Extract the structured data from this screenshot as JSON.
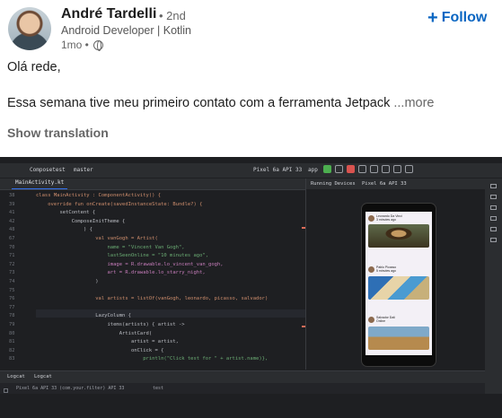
{
  "post": {
    "author_name": "André Tardelli",
    "degree": "• 2nd",
    "headline": "Android Developer | Kotlin",
    "time": "1mo •",
    "follow_label": "Follow",
    "greeting": "Olá rede,",
    "body_text": "Essa semana tive meu primeiro contato com a ferramenta Jetpack",
    "more_label": "...more",
    "show_translation": "Show translation"
  },
  "ide": {
    "project": "Composetest",
    "branch": "master",
    "device": "Pixel 6a API 33",
    "run_config": "app",
    "editor_tab": "MainActivity.kt",
    "preview_tabs": [
      "Running Devices",
      "Pixel 6a API 33"
    ],
    "bottom_tabs": [
      "Logcat",
      "Logcat"
    ],
    "logcat_device": "Pixel 6a API 33 (com.your.filter)  API 33",
    "logcat_filter": "test",
    "code_lines": [
      {
        "num": "38",
        "text": "class MainActivity : ComponentActivity() {"
      },
      {
        "num": "39",
        "text": "    override fun onCreate(savedInstanceState: Bundle?) {"
      },
      {
        "num": "41",
        "text": "        setContent {"
      },
      {
        "num": "42",
        "text": "            ComposeInitTheme {"
      },
      {
        "num": "48",
        "text": "                ) {"
      },
      {
        "num": "67",
        "text": "                    val vanGogh = Artist("
      },
      {
        "num": "70",
        "text": "                        name = \"Vincent Van Gogh\","
      },
      {
        "num": "71",
        "text": "                        lastSeenOnline = \"10 minutes ago\","
      },
      {
        "num": "72",
        "text": "                        image = R.drawable.lo_vincent_van_gogh,"
      },
      {
        "num": "73",
        "text": "                        art = R.drawable.lo_starry_night,"
      },
      {
        "num": "74",
        "text": "                    )"
      },
      {
        "num": "75",
        "text": ""
      },
      {
        "num": "76",
        "text": "                    val artists = listOf(vanGogh, leonardo, picasso, salvador)"
      },
      {
        "num": "77",
        "text": ""
      },
      {
        "num": "78",
        "text": "                    LazyColumn {"
      },
      {
        "num": "79",
        "text": "                        items(artists) { artist ->"
      },
      {
        "num": "80",
        "text": "                            ArtistCard("
      },
      {
        "num": "81",
        "text": "                                artist = artist,"
      },
      {
        "num": "82",
        "text": "                                onClick = {"
      },
      {
        "num": "83",
        "text": "                                    println(\"Click test for \" + artist.name)},"
      }
    ],
    "preview_cards": [
      {
        "name": "Leonardo Da Vinci",
        "status": "3 minutes ago"
      },
      {
        "name": "Pablo Picasso",
        "status": "5 minutes ago"
      },
      {
        "name": "Salvador Dalí",
        "status": "Online"
      }
    ]
  }
}
